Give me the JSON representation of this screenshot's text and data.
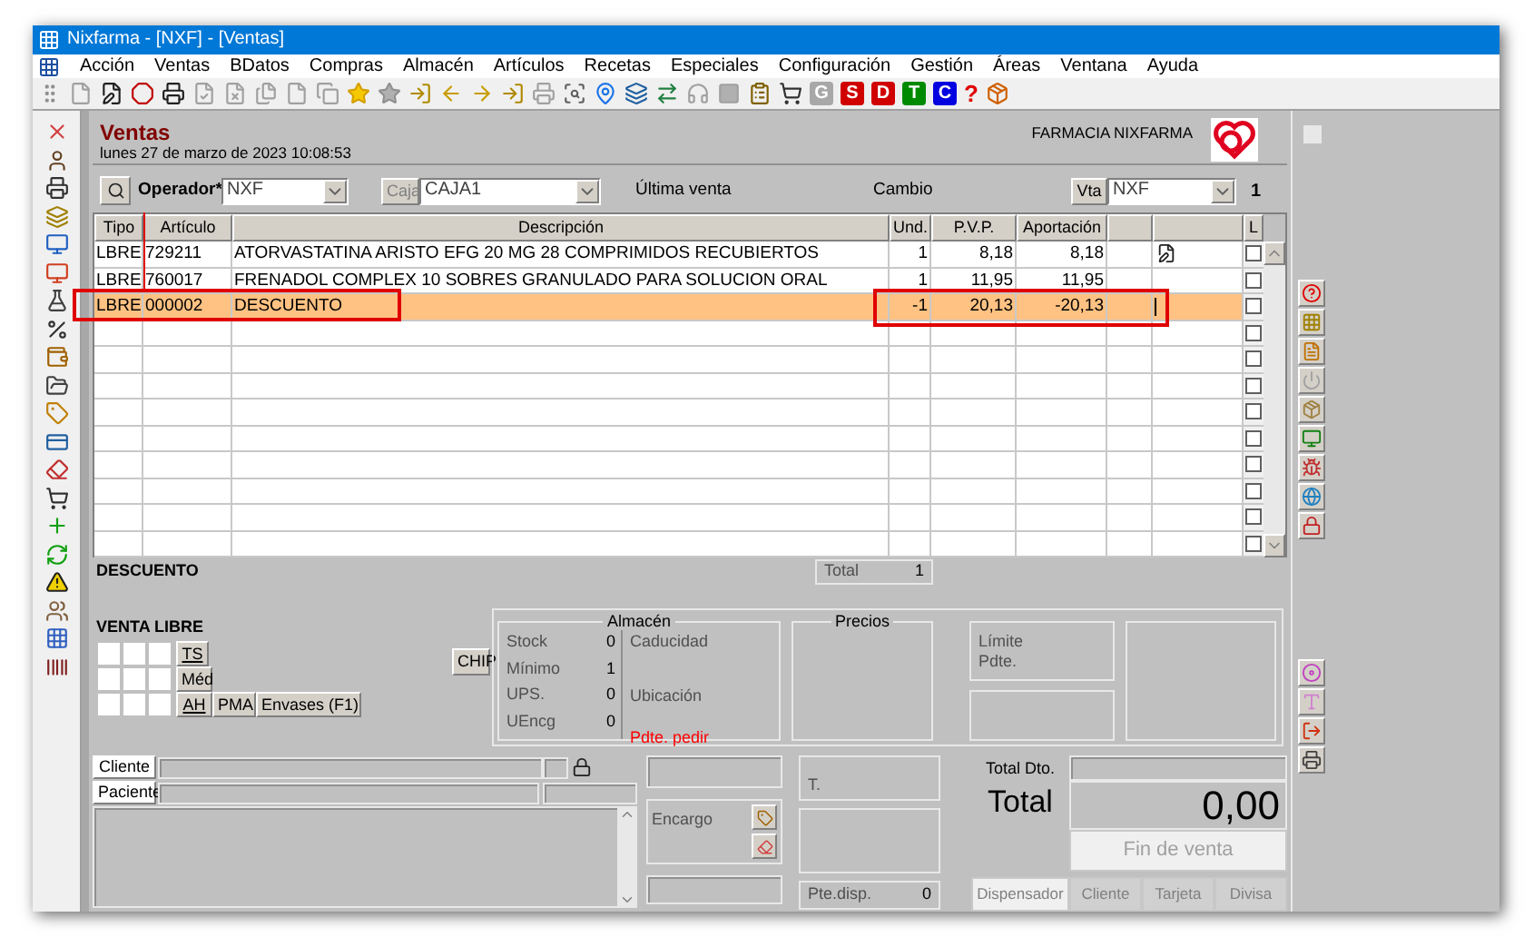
{
  "window": {
    "title": "Nixfarma - [NXF] - [Ventas]"
  },
  "menu": [
    "Acción",
    "Ventas",
    "BDatos",
    "Compras",
    "Almacén",
    "Artículos",
    "Recetas",
    "Especiales",
    "Configuración",
    "Gestión",
    "Áreas",
    "Ventana",
    "Ayuda"
  ],
  "toolbar_letters": [
    {
      "label": "G",
      "color": "#a8a8a8"
    },
    {
      "label": "S",
      "color": "#d00000"
    },
    {
      "label": "D",
      "color": "#d00000"
    },
    {
      "label": "T",
      "color": "#008a00"
    },
    {
      "label": "C",
      "color": "#0000e0"
    }
  ],
  "toolbar_help": "?",
  "header": {
    "title": "Ventas",
    "date": "lunes 27 de marzo de 2023 10:08:53",
    "pharmacy": "FARMACIA NIXFARMA"
  },
  "operator": {
    "label": "Operador*",
    "value": "NXF"
  },
  "caja": {
    "label": "Caja",
    "value": "CAJA1"
  },
  "last_sale": "Última venta",
  "change": "Cambio",
  "vta": {
    "label": "Vta",
    "value": "NXF",
    "count": "1"
  },
  "table": {
    "columns": [
      "Tipo",
      "Artículo",
      "Descripción",
      "Und.",
      "P.V.P.",
      "Aportación"
    ],
    "l_column": "L",
    "rows": [
      {
        "tipo": "LBRE",
        "articulo": "729211",
        "descripcion": "ATORVASTATINA  ARISTO EFG 20 MG 28 COMPRIMIDOS RECUBIERTOS",
        "und": "1",
        "pvp": "8,18",
        "aportacion": "8,18",
        "flagged": true,
        "checked": false,
        "selected": false
      },
      {
        "tipo": "LBRE",
        "articulo": "760017",
        "descripcion": "FRENADOL COMPLEX 10 SOBRES GRANULADO PARA SOLUCION ORAL",
        "und": "1",
        "pvp": "11,95",
        "aportacion": "11,95",
        "flagged": false,
        "checked": false,
        "selected": false
      },
      {
        "tipo": "LBRE",
        "articulo": "000002",
        "descripcion": "DESCUENTO",
        "und": "-1",
        "pvp": "20,13",
        "aportacion": "-20,13",
        "flagged": false,
        "checked": false,
        "selected": true
      }
    ]
  },
  "blank_rows": [
    {
      "checked": false
    },
    {
      "checked": false
    },
    {
      "checked": false
    },
    {
      "checked": false
    },
    {
      "checked": false
    },
    {
      "checked": false
    },
    {
      "checked": false
    },
    {
      "checked": false
    },
    {
      "checked": false
    }
  ],
  "selection_label": "DESCUENTO",
  "total": {
    "label": "Total",
    "value": "1"
  },
  "venta_libre": {
    "title": "VENTA LIBRE",
    "buttons": [
      "TS",
      "Méd",
      "AH",
      "PMA",
      "Envases (F1)"
    ]
  },
  "chip": "CHIP",
  "almacen": {
    "title": "Almacén",
    "rows": [
      {
        "label": "Stock",
        "value": "0"
      },
      {
        "label": "Mínimo",
        "value": "1"
      },
      {
        "label": "UPS.",
        "value": "0"
      },
      {
        "label": "UEncg",
        "value": "0"
      }
    ],
    "caducidad": "Caducidad",
    "ubicacion": "Ubicación",
    "alert": "Pdte. pedir"
  },
  "precios": {
    "title": "Precios"
  },
  "limits": [
    "Límite",
    "Pdte."
  ],
  "cliente": {
    "client_button": "Cliente",
    "patient_button": "Paciente"
  },
  "encargo": "Encargo",
  "t_label": "T.",
  "pte_disp": {
    "label": "Pte.disp.",
    "value": "0"
  },
  "totals": {
    "discount_label": "Total Dto.",
    "total_label": "Total",
    "amount": "0,00",
    "finish": {
      "label": "Fin de venta",
      "disabled": true
    }
  },
  "payment_buttons": [
    {
      "label": "Dispensador",
      "active": true
    },
    {
      "label": "Cliente",
      "active": false
    },
    {
      "label": "Tarjeta",
      "active": false
    },
    {
      "label": "Divisa",
      "active": false
    }
  ]
}
